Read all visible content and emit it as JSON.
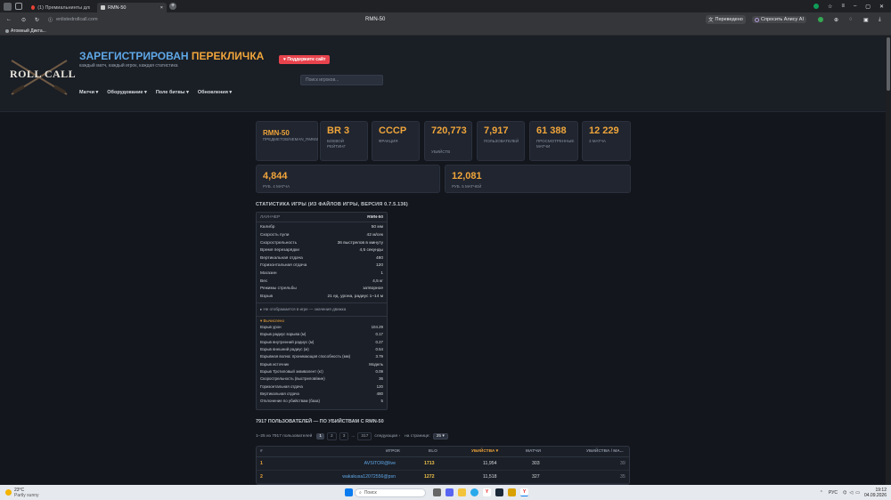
{
  "browser": {
    "tabs": [
      {
        "label": "(1) Премиальнинты для р..."
      },
      {
        "label": "RMN-50"
      }
    ],
    "url": "enlistedrollcall.com",
    "page_title_center": "RMN-50",
    "translated_label": "Переведено",
    "alice_label": "Спросить Алису AI",
    "bookmark": "Атомный Дикта..."
  },
  "site": {
    "logo_text": "ROLL CALL",
    "title_a": "ЗАРЕГИСТРИРОВАН",
    "title_b": "ПЕРЕКЛИЧКА",
    "tagline": "каждый матч, каждый игрок, каждая статистика",
    "support_button": "♥ Поддержите сайт",
    "search_placeholder": "Поиск игроков...",
    "nav": [
      "Матчи",
      "Оборудование",
      "Поле битвы",
      "Обновления"
    ]
  },
  "cards": [
    {
      "value": "RMN-50",
      "label": "ПРЕДМЕТОВ/NEMAN_RMN50"
    },
    {
      "value": "BR 3",
      "label": "БОЕВОЙ РЕЙТИНГ"
    },
    {
      "value": "СССР",
      "label": "ФРАКЦИЯ"
    },
    {
      "value": "720,773",
      "label": "УБИЙСТВ"
    },
    {
      "value": "7,917",
      "label": "ПОЛЬЗОВАТЕЛЕЙ"
    },
    {
      "value": "61 388",
      "label": "ПРОСМОТРЕННЫЕ МАТЧИ"
    },
    {
      "value": "12 229",
      "label": "3 МАТЧА"
    },
    {
      "value": "4,844",
      "label": "РУБ. 4 МАТЧА"
    },
    {
      "value": "12,081",
      "label": "РУБ. 5 МАТЧЕЙ"
    }
  ],
  "stats_section_title": "СТАТИСТИКА ИГРЫ (ИЗ ФАЙЛОВ ИГРЫ, ВЕРСИЯ 0.7.5.136)",
  "stats": {
    "head_left": "ЛАУНЧЕР",
    "head_right": "RMN-50",
    "rows": [
      {
        "k": "Калибр",
        "v": "50 мм"
      },
      {
        "k": "Скорость пули",
        "v": "42 м/сек"
      },
      {
        "k": "Скорострельность",
        "v": "36 выстрелов в минуту"
      },
      {
        "k": "Время перезарядки",
        "v": "4,5 секунды"
      },
      {
        "k": "Вертикальная отдача",
        "v": "480"
      },
      {
        "k": "Горизонтальная отдача",
        "v": "120"
      },
      {
        "k": "Магазин",
        "v": "1"
      },
      {
        "k": "Вес",
        "v": "4,5 кг"
      },
      {
        "k": "Режимы стрельбы",
        "v": "затворное"
      },
      {
        "k": "Взрыв",
        "v": "21 ед. урона, радиус 1–14 м"
      }
    ],
    "hidden_toggle": "▸ Не отображается в игре — значения движка",
    "calc_toggle": "▾ Вычислено",
    "calc_rows": [
      {
        "k": "Взрыв урон",
        "v": "104.29"
      },
      {
        "k": "Взрыв радиус взрыва (м)",
        "v": "0.17"
      },
      {
        "k": "Взрыв внутренний радиус (м)",
        "v": "0.27"
      },
      {
        "k": "Взрыв внешний радиус (м)",
        "v": "0.54"
      },
      {
        "k": "Взрывная волна: проникающая способность (мм)",
        "v": "3.79"
      },
      {
        "k": "Взрыв источник",
        "v": "Модель"
      },
      {
        "k": "Взрыв Тротиловый эквивалент (кг)",
        "v": "0.09"
      },
      {
        "k": "Скорострельность (выстрелов/мин)",
        "v": "36"
      },
      {
        "k": "Горизонтальная отдача",
        "v": "120"
      },
      {
        "k": "Вертикальная отдача",
        "v": "480"
      },
      {
        "k": "Отклонение по убийствам (база)",
        "v": "5"
      }
    ]
  },
  "users_title": "7917 ПОЛЬЗОВАТЕЛЕЙ — ПО УБИЙСТВАМ С RMN-50",
  "pagination": {
    "range": "1–25 из 7917 пользователей",
    "pages": [
      "1",
      "2",
      "3",
      "...",
      "317"
    ],
    "next": "следующая ›",
    "per_page_label": "на странице:",
    "per_page": "25"
  },
  "table": {
    "headers": [
      "#",
      "ИГРОК",
      "ELO",
      "УБИЙСТВА ▾",
      "МАТЧИ",
      "УБИЙСТВА / МА..."
    ],
    "rows": [
      {
        "rank": "1",
        "player": "AVSITOR@live",
        "elo": "1713",
        "kills": "11,954",
        "matches": "303",
        "kpm": "39"
      },
      {
        "rank": "2",
        "player": "wakakusa12072556@psn",
        "elo": "1272",
        "kills": "11,518",
        "matches": "327",
        "kpm": "35"
      }
    ]
  },
  "taskbar": {
    "temp": "23°C",
    "weather": "Partly sunny",
    "search": "Поиск",
    "lang": "РУС",
    "time": "19:12",
    "date": "04.09.2026"
  }
}
